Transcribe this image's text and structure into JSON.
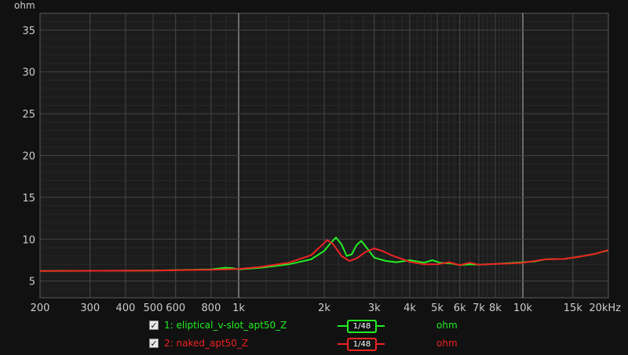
{
  "chart_data": {
    "type": "line",
    "title": "",
    "ylabel": "ohm",
    "xlabel": "",
    "x_scale": "log",
    "xlim": [
      200,
      20000
    ],
    "ylim": [
      3,
      37
    ],
    "grid": true,
    "y_ticks": [
      5,
      10,
      15,
      20,
      25,
      30,
      35
    ],
    "x_ticks": [
      {
        "v": 200,
        "label": "200"
      },
      {
        "v": 300,
        "label": "300"
      },
      {
        "v": 400,
        "label": "400"
      },
      {
        "v": 500,
        "label": "500"
      },
      {
        "v": 600,
        "label": "600"
      },
      {
        "v": 800,
        "label": "800"
      },
      {
        "v": 1000,
        "label": "1k"
      },
      {
        "v": 2000,
        "label": "2k"
      },
      {
        "v": 3000,
        "label": "3k"
      },
      {
        "v": 4000,
        "label": "4k"
      },
      {
        "v": 5000,
        "label": "5k"
      },
      {
        "v": 6000,
        "label": "6k"
      },
      {
        "v": 7000,
        "label": "7k"
      },
      {
        "v": 8000,
        "label": "8k"
      },
      {
        "v": 10000,
        "label": "10k"
      },
      {
        "v": 15000,
        "label": "15k"
      },
      {
        "v": 20000,
        "label": "20kHz"
      }
    ],
    "series": [
      {
        "name": "1: eliptical_v-slot_apt50_Z",
        "color": "#22ee22",
        "x": [
          200,
          500,
          800,
          900,
          950,
          1000,
          1200,
          1500,
          1800,
          2000,
          2100,
          2200,
          2300,
          2400,
          2500,
          2600,
          2700,
          2850,
          3000,
          3300,
          3600,
          4000,
          4500,
          4800,
          5100,
          5600,
          6000,
          6500,
          7000,
          8000,
          9000,
          10000,
          11000,
          12000,
          14000,
          16000,
          18000,
          19000,
          20000
        ],
        "y": [
          6.2,
          6.25,
          6.4,
          6.6,
          6.55,
          6.4,
          6.6,
          7.0,
          7.6,
          8.6,
          9.5,
          10.2,
          9.4,
          8.0,
          8.2,
          9.3,
          9.8,
          8.8,
          7.8,
          7.4,
          7.25,
          7.5,
          7.2,
          7.5,
          7.2,
          7.1,
          6.9,
          7.0,
          6.95,
          7.05,
          7.15,
          7.25,
          7.35,
          7.6,
          7.65,
          7.95,
          8.25,
          8.5,
          8.65
        ]
      },
      {
        "name": "2: naked_apt50_Z",
        "color": "#ee2222",
        "x": [
          200,
          500,
          800,
          1000,
          1200,
          1500,
          1800,
          1950,
          2050,
          2150,
          2300,
          2450,
          2600,
          2800,
          3000,
          3200,
          3500,
          4000,
          4500,
          5000,
          5500,
          6000,
          6500,
          7000,
          8000,
          9000,
          10000,
          11000,
          12000,
          14000,
          16000,
          18000,
          19000,
          20000
        ],
        "y": [
          6.2,
          6.25,
          6.35,
          6.45,
          6.7,
          7.2,
          8.1,
          9.2,
          9.9,
          9.4,
          8.0,
          7.4,
          7.7,
          8.5,
          8.9,
          8.6,
          8.0,
          7.3,
          7.0,
          7.0,
          7.25,
          6.9,
          7.2,
          6.95,
          7.05,
          7.1,
          7.2,
          7.4,
          7.6,
          7.65,
          7.95,
          8.25,
          8.5,
          8.7
        ]
      }
    ]
  },
  "legend": [
    {
      "label": "1: eliptical_v-slot_apt50_Z",
      "smoothing": "1/48",
      "unit": "ohm",
      "color": "#22ee22",
      "checked": true
    },
    {
      "label": "2: naked_apt50_Z",
      "smoothing": "1/48",
      "unit": "ohm",
      "color": "#ee2222",
      "checked": true
    }
  ]
}
